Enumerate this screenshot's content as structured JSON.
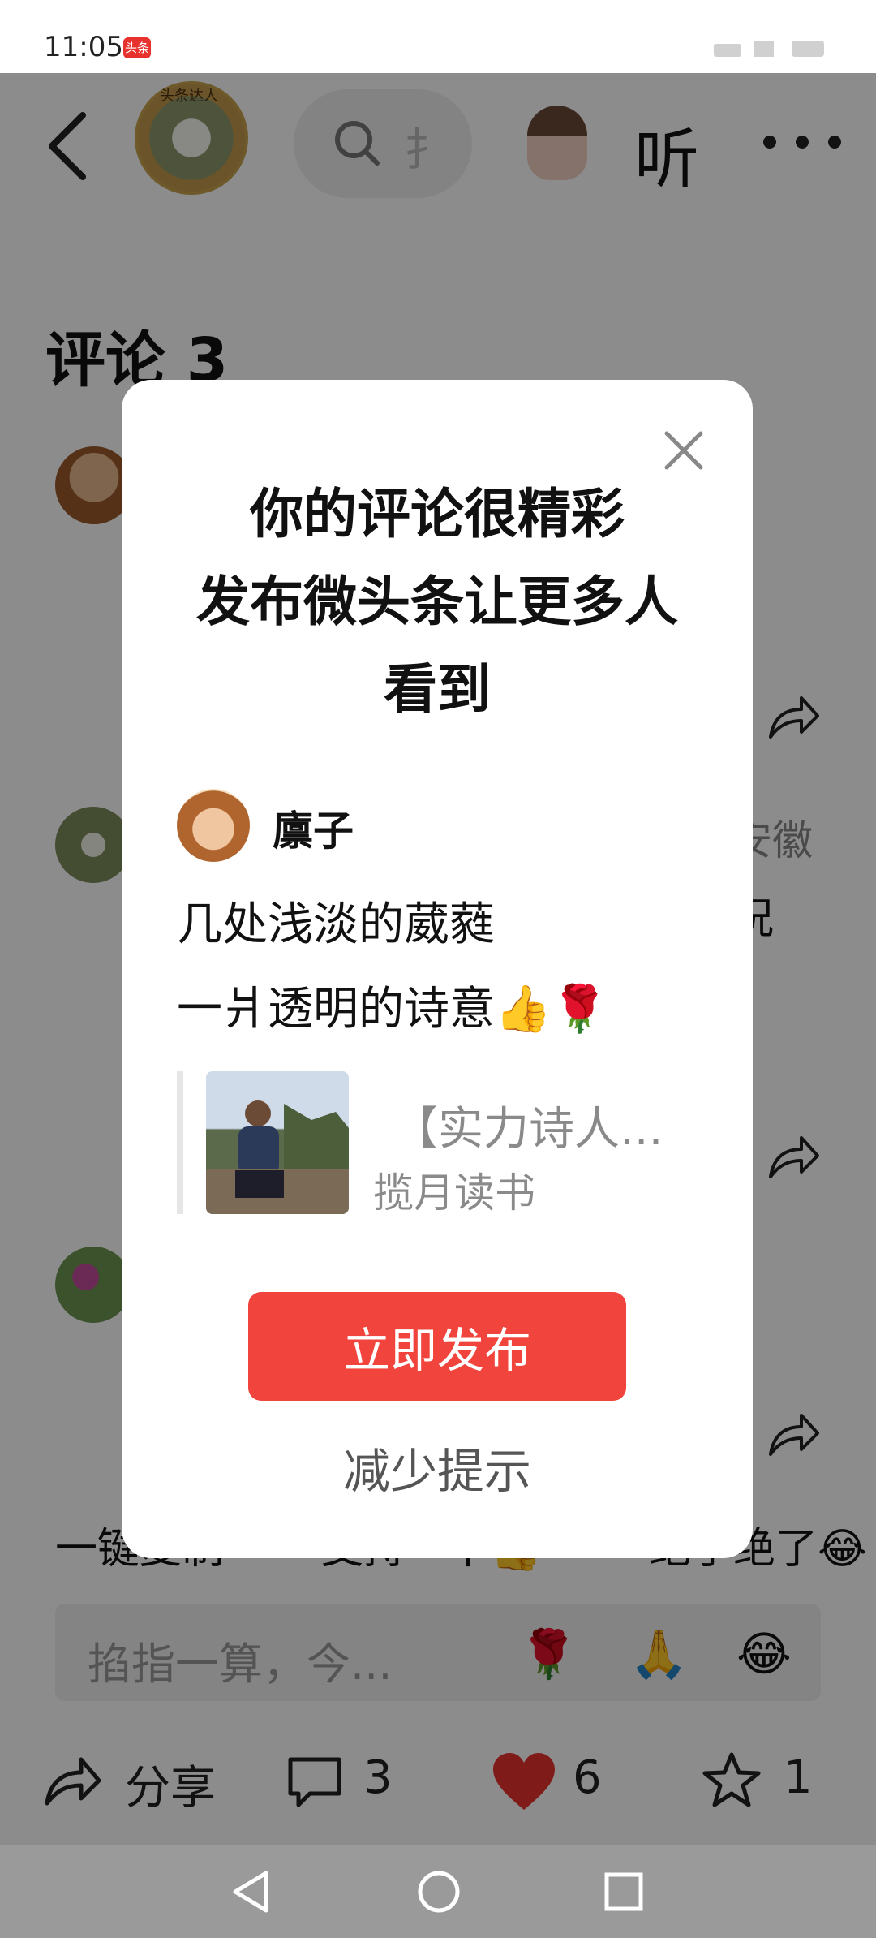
{
  "status_bar": {
    "time": "11:05",
    "app_badge": "头条"
  },
  "header": {
    "author_tag": "头条达人",
    "search_char": "扌",
    "listen_label": "听"
  },
  "comments": {
    "title": "评论 3",
    "bg_fragment_1": "安徽",
    "bg_fragment_2": "况",
    "quick_replies": [
      "一键复制",
      "支持一下👍",
      "绝了绝了😂"
    ],
    "reply_placeholder": "掐指一算，今...",
    "reply_emojis": [
      "🌹",
      "🙏",
      "😂"
    ]
  },
  "bottom_bar": {
    "share_label": "分享",
    "comment_count": "3",
    "like_count": "6",
    "fav_count": "1"
  },
  "dialog": {
    "title_lines": [
      "你的评论很精彩",
      "发布微头条让更多人",
      "看到"
    ],
    "user_name": "廪子",
    "poem_lines": [
      "几处浅淡的葳蕤",
      "一爿透明的诗意👍🌹"
    ],
    "quote_title": "【实力诗人...",
    "quote_source": "揽月读书",
    "publish_label": "立即发布",
    "reduce_label": "减少提示"
  },
  "colors": {
    "accent": "#f0443c",
    "like": "#e8322e"
  }
}
